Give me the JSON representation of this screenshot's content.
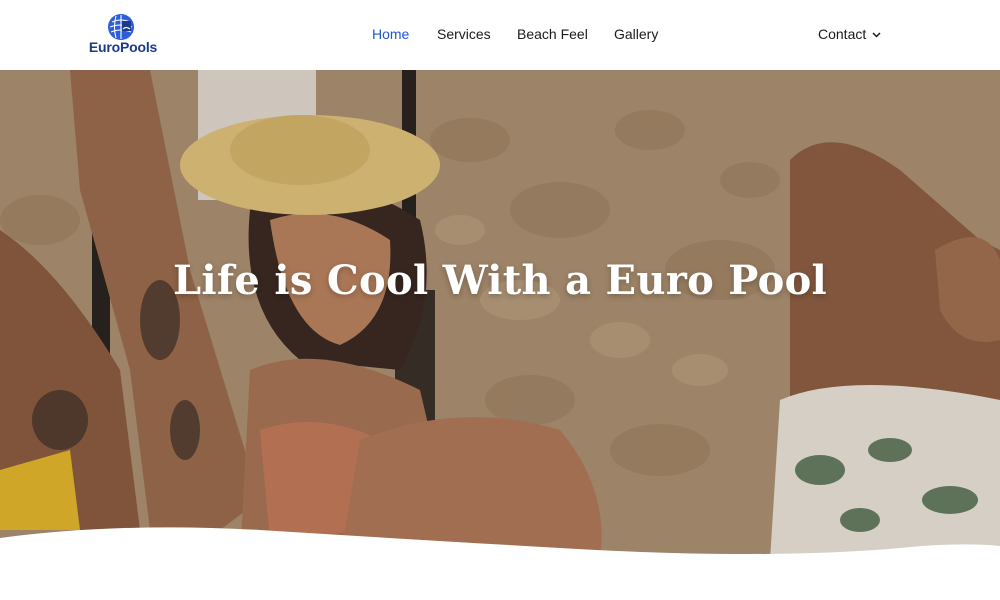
{
  "brand": {
    "name": "EuroPools",
    "logo_icon": "globe-pool-icon"
  },
  "nav": {
    "items": [
      {
        "label": "Home",
        "active": true
      },
      {
        "label": "Services",
        "active": false
      },
      {
        "label": "Beach Feel",
        "active": false
      },
      {
        "label": "Gallery",
        "active": false
      }
    ],
    "contact": {
      "label": "Contact",
      "icon": "chevron-down-icon"
    }
  },
  "hero": {
    "title": "Life is Cool With a Euro Pool"
  },
  "colors": {
    "accent": "#1e57d6",
    "brand": "#1b3a8c",
    "text": "#1a1a1a",
    "hero_text": "#ffffff"
  }
}
